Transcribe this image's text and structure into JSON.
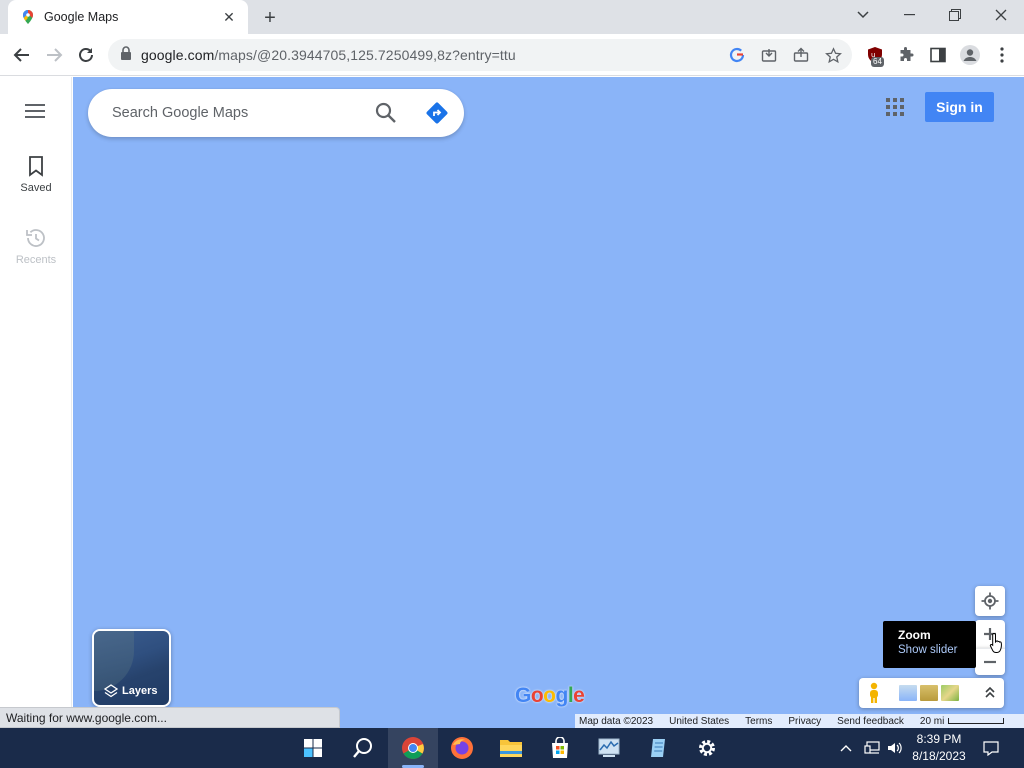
{
  "browser": {
    "tab_title": "Google Maps",
    "url_host": "google.com",
    "url_rest": "/maps/@20.3944705,125.7250499,8z?entry=ttu",
    "extension_badge": "64",
    "status_text": "Waiting for www.google.com..."
  },
  "maps": {
    "search_placeholder": "Search Google Maps",
    "signin_label": "Sign in",
    "sidebar": {
      "saved_label": "Saved",
      "recents_label": "Recents"
    },
    "layers_label": "Layers",
    "logo_text": "Google",
    "tooltip": {
      "title": "Zoom",
      "subtitle": "Show slider"
    },
    "footer": {
      "map_data": "Map data ©2023",
      "country": "United States",
      "terms": "Terms",
      "privacy": "Privacy",
      "feedback": "Send feedback",
      "scale": "20 mi"
    },
    "water_color": "#8ab4f8",
    "accent_color": "#4285f4"
  },
  "taskbar": {
    "time": "8:39 PM",
    "date": "8/18/2023",
    "apps": [
      "start-icon",
      "search-icon",
      "chrome-icon",
      "firefox-icon",
      "file-explorer-icon",
      "store-icon",
      "task-manager-icon",
      "notepad-icon",
      "settings-icon"
    ]
  }
}
